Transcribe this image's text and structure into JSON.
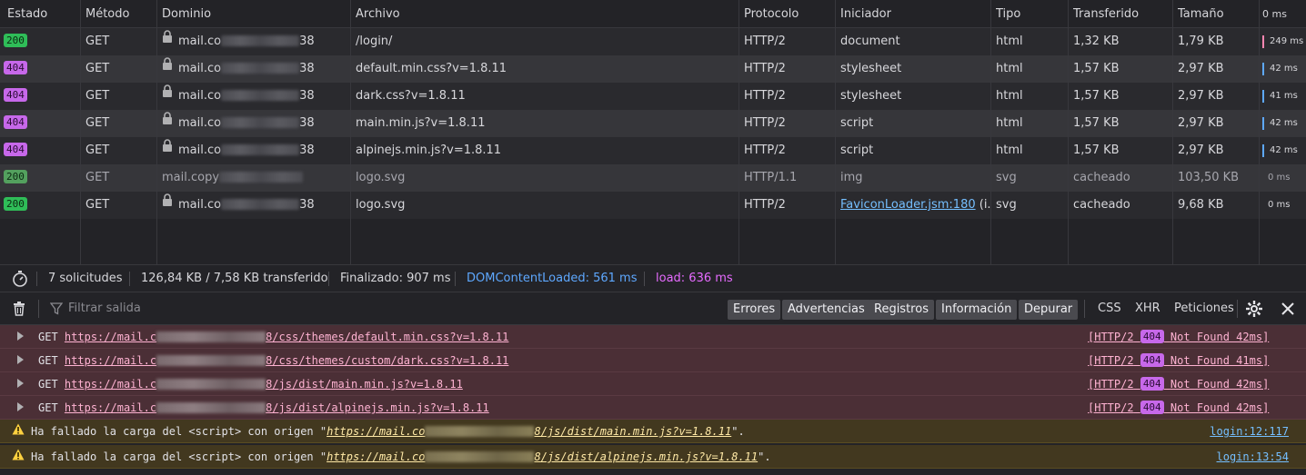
{
  "network": {
    "columns": {
      "status": "Estado",
      "method": "Método",
      "domain": "Dominio",
      "file": "Archivo",
      "protocol": "Protocolo",
      "initiator": "Iniciador",
      "type": "Tipo",
      "transferred": "Transferido",
      "size": "Tamaño",
      "time": "0 ms"
    },
    "rows": [
      {
        "status": "200",
        "method": "GET",
        "domain_start": "mail.co",
        "domain_end": "38",
        "file": "/login/",
        "protocol": "HTTP/2",
        "initiator": "document",
        "type": "html",
        "transferred": "1,32 KB",
        "size": "1,79 KB",
        "time": "249 ms"
      },
      {
        "status": "404",
        "method": "GET",
        "domain_start": "mail.co",
        "domain_end": "38",
        "file": "default.min.css?v=1.8.11",
        "protocol": "HTTP/2",
        "initiator": "stylesheet",
        "type": "html",
        "transferred": "1,57 KB",
        "size": "2,97 KB",
        "time": "42 ms"
      },
      {
        "status": "404",
        "method": "GET",
        "domain_start": "mail.co",
        "domain_end": "38",
        "file": "dark.css?v=1.8.11",
        "protocol": "HTTP/2",
        "initiator": "stylesheet",
        "type": "html",
        "transferred": "1,57 KB",
        "size": "2,97 KB",
        "time": "41 ms"
      },
      {
        "status": "404",
        "method": "GET",
        "domain_start": "mail.co",
        "domain_end": "38",
        "file": "main.min.js?v=1.8.11",
        "protocol": "HTTP/2",
        "initiator": "script",
        "type": "html",
        "transferred": "1,57 KB",
        "size": "2,97 KB",
        "time": "42 ms"
      },
      {
        "status": "404",
        "method": "GET",
        "domain_start": "mail.co",
        "domain_end": "38",
        "file": "alpinejs.min.js?v=1.8.11",
        "protocol": "HTTP/2",
        "initiator": "script",
        "type": "html",
        "transferred": "1,57 KB",
        "size": "2,97 KB",
        "time": "42 ms"
      },
      {
        "status": "200",
        "method": "GET",
        "domain_start": "mail.copy",
        "domain_end": "",
        "file": "logo.svg",
        "protocol": "HTTP/1.1",
        "initiator": "img",
        "type": "svg",
        "transferred": "cacheado",
        "size": "103,50 KB",
        "time": "0 ms"
      },
      {
        "status": "200",
        "method": "GET",
        "domain_start": "mail.co",
        "domain_end": "38",
        "file": "logo.svg",
        "protocol": "HTTP/2",
        "initiator": "FaviconLoader.jsm:180",
        "initiator_suffix": "(i...",
        "type": "svg",
        "transferred": "cacheado",
        "size": "9,68 KB",
        "time": "0 ms"
      }
    ]
  },
  "summary": {
    "requests": "7 solicitudes",
    "transferred": "126,84 KB / 7,58 KB transferido",
    "finished": "Finalizado: 907 ms",
    "dcl": "DOMContentLoaded: 561 ms",
    "load": "load: 636 ms"
  },
  "console_toolbar": {
    "filter_placeholder": "Filtrar salida",
    "levels": [
      "Errores",
      "Advertencias",
      "Registros",
      "Información",
      "Depurar"
    ],
    "types": [
      "CSS",
      "XHR",
      "Peticiones"
    ]
  },
  "console": {
    "errors": [
      {
        "method": "GET",
        "url_start": "https://mail.c",
        "url_end": "8/css/themes/default.min.css?v=1.8.11",
        "proto": "[HTTP/2",
        "code": "404",
        "status": "Not Found 42ms]"
      },
      {
        "method": "GET",
        "url_start": "https://mail.c",
        "url_end": "8/css/themes/custom/dark.css?v=1.8.11",
        "proto": "[HTTP/2",
        "code": "404",
        "status": "Not Found 41ms]"
      },
      {
        "method": "GET",
        "url_start": "https://mail.c",
        "url_end": "8/js/dist/main.min.js?v=1.8.11",
        "proto": "[HTTP/2",
        "code": "404",
        "status": "Not Found 42ms]"
      },
      {
        "method": "GET",
        "url_start": "https://mail.c",
        "url_end": "8/js/dist/alpinejs.min.js?v=1.8.11",
        "proto": "[HTTP/2",
        "code": "404",
        "status": "Not Found 42ms]"
      }
    ],
    "warnings": [
      {
        "prefix": "Ha fallado la carga del <script> con origen \"",
        "url_start": "https://mail.co",
        "url_end": "8/js/dist/main.min.js?v=1.8.11",
        "suffix": "\".",
        "source": "login:12:117"
      },
      {
        "prefix": "Ha fallado la carga del <script> con origen \"",
        "url_start": "https://mail.co",
        "url_end": "8/js/dist/alpinejs.min.js?v=1.8.11",
        "suffix": "\".",
        "source": "login:13:54"
      }
    ]
  },
  "colors": {
    "ok": "#2fbd58",
    "notfound": "#c768ea",
    "dcl": "#5ea8ff",
    "load": "#e66bff",
    "error_bg": "#4b2f36",
    "warn_bg": "#42381f"
  }
}
